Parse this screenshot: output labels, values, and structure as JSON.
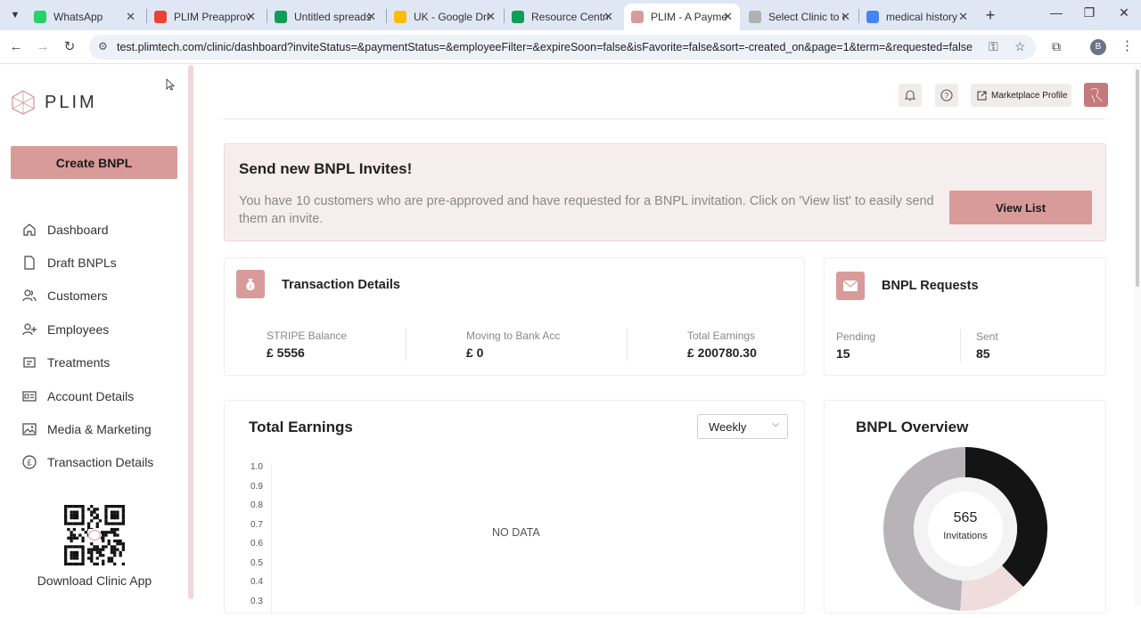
{
  "browser": {
    "tabs": [
      {
        "label": "WhatsApp",
        "active": false,
        "favicon_color": "#25d366",
        "icon": "whatsapp-icon"
      },
      {
        "label": "PLIM Preapproved",
        "active": false,
        "favicon_color": "#ea4335",
        "icon": "gmail-icon"
      },
      {
        "label": "Untitled spreadsheet",
        "active": false,
        "favicon_color": "#0f9d58",
        "icon": "sheets-icon"
      },
      {
        "label": "UK - Google Drive",
        "active": false,
        "favicon_color": "#fbbc04",
        "icon": "drive-icon"
      },
      {
        "label": "Resource Centre",
        "active": false,
        "favicon_color": "#0f9d58",
        "icon": "sheets-icon"
      },
      {
        "label": "PLIM - A Payment",
        "active": true,
        "favicon_color": "#d99a9a",
        "icon": "plim-icon"
      },
      {
        "label": "Select Clinic to c",
        "active": false,
        "favicon_color": "#b0b0b0",
        "icon": "plim-icon"
      },
      {
        "label": "medical history",
        "active": false,
        "favicon_color": "#4285f4",
        "icon": "google-icon"
      }
    ],
    "url": "test.plimtech.com/clinic/dashboard?inviteStatus=&paymentStatus=&employeeFilter=&expireSoon=false&isFavorite=false&sort=-created_on&page=1&term=&requested=false",
    "profile_initial": "B"
  },
  "sidebar": {
    "logo_text": "PLIM",
    "create_label": "Create BNPL",
    "items": [
      {
        "label": "Dashboard",
        "icon": "home-icon"
      },
      {
        "label": "Draft BNPLs",
        "icon": "document-icon"
      },
      {
        "label": "Customers",
        "icon": "users-icon"
      },
      {
        "label": "Employees",
        "icon": "user-plus-icon"
      },
      {
        "label": "Treatments",
        "icon": "treatments-icon"
      },
      {
        "label": "Account Details",
        "icon": "id-card-icon"
      },
      {
        "label": "Media & Marketing",
        "icon": "image-icon"
      },
      {
        "label": "Transaction Details",
        "icon": "pound-icon"
      }
    ],
    "download_label": "Download Clinic App"
  },
  "header": {
    "marketplace_label": "Marketplace Profile"
  },
  "invite": {
    "title": "Send new BNPL Invites!",
    "text": "You have 10 customers who are pre-approved and have requested for a BNPL invitation. Click on 'View list' to easily send them an invite.",
    "button": "View List"
  },
  "transactions": {
    "title": "Transaction Details",
    "stats": [
      {
        "label": "STRIPE Balance",
        "value": "£ 5556"
      },
      {
        "label": "Moving to Bank Acc",
        "value": "£ 0"
      },
      {
        "label": "Total Earnings",
        "value": "£ 200780.30"
      }
    ]
  },
  "requests": {
    "title": "BNPL Requests",
    "pending_label": "Pending",
    "pending_value": "15",
    "sent_label": "Sent",
    "sent_value": "85"
  },
  "earnings": {
    "title": "Total Earnings",
    "period": "Weekly",
    "no_data": "NO DATA",
    "y_ticks": [
      "1.0",
      "0.9",
      "0.8",
      "0.7",
      "0.6",
      "0.5",
      "0.4",
      "0.3"
    ]
  },
  "overview": {
    "title": "BNPL Overview",
    "center_value": "565",
    "center_label": "Invitations",
    "segments": [
      {
        "fraction": 0.375,
        "color": "#141414"
      },
      {
        "fraction": 0.135,
        "color": "#efdcdc"
      },
      {
        "fraction": 0.49,
        "color": "#b7b3b6"
      }
    ]
  }
}
